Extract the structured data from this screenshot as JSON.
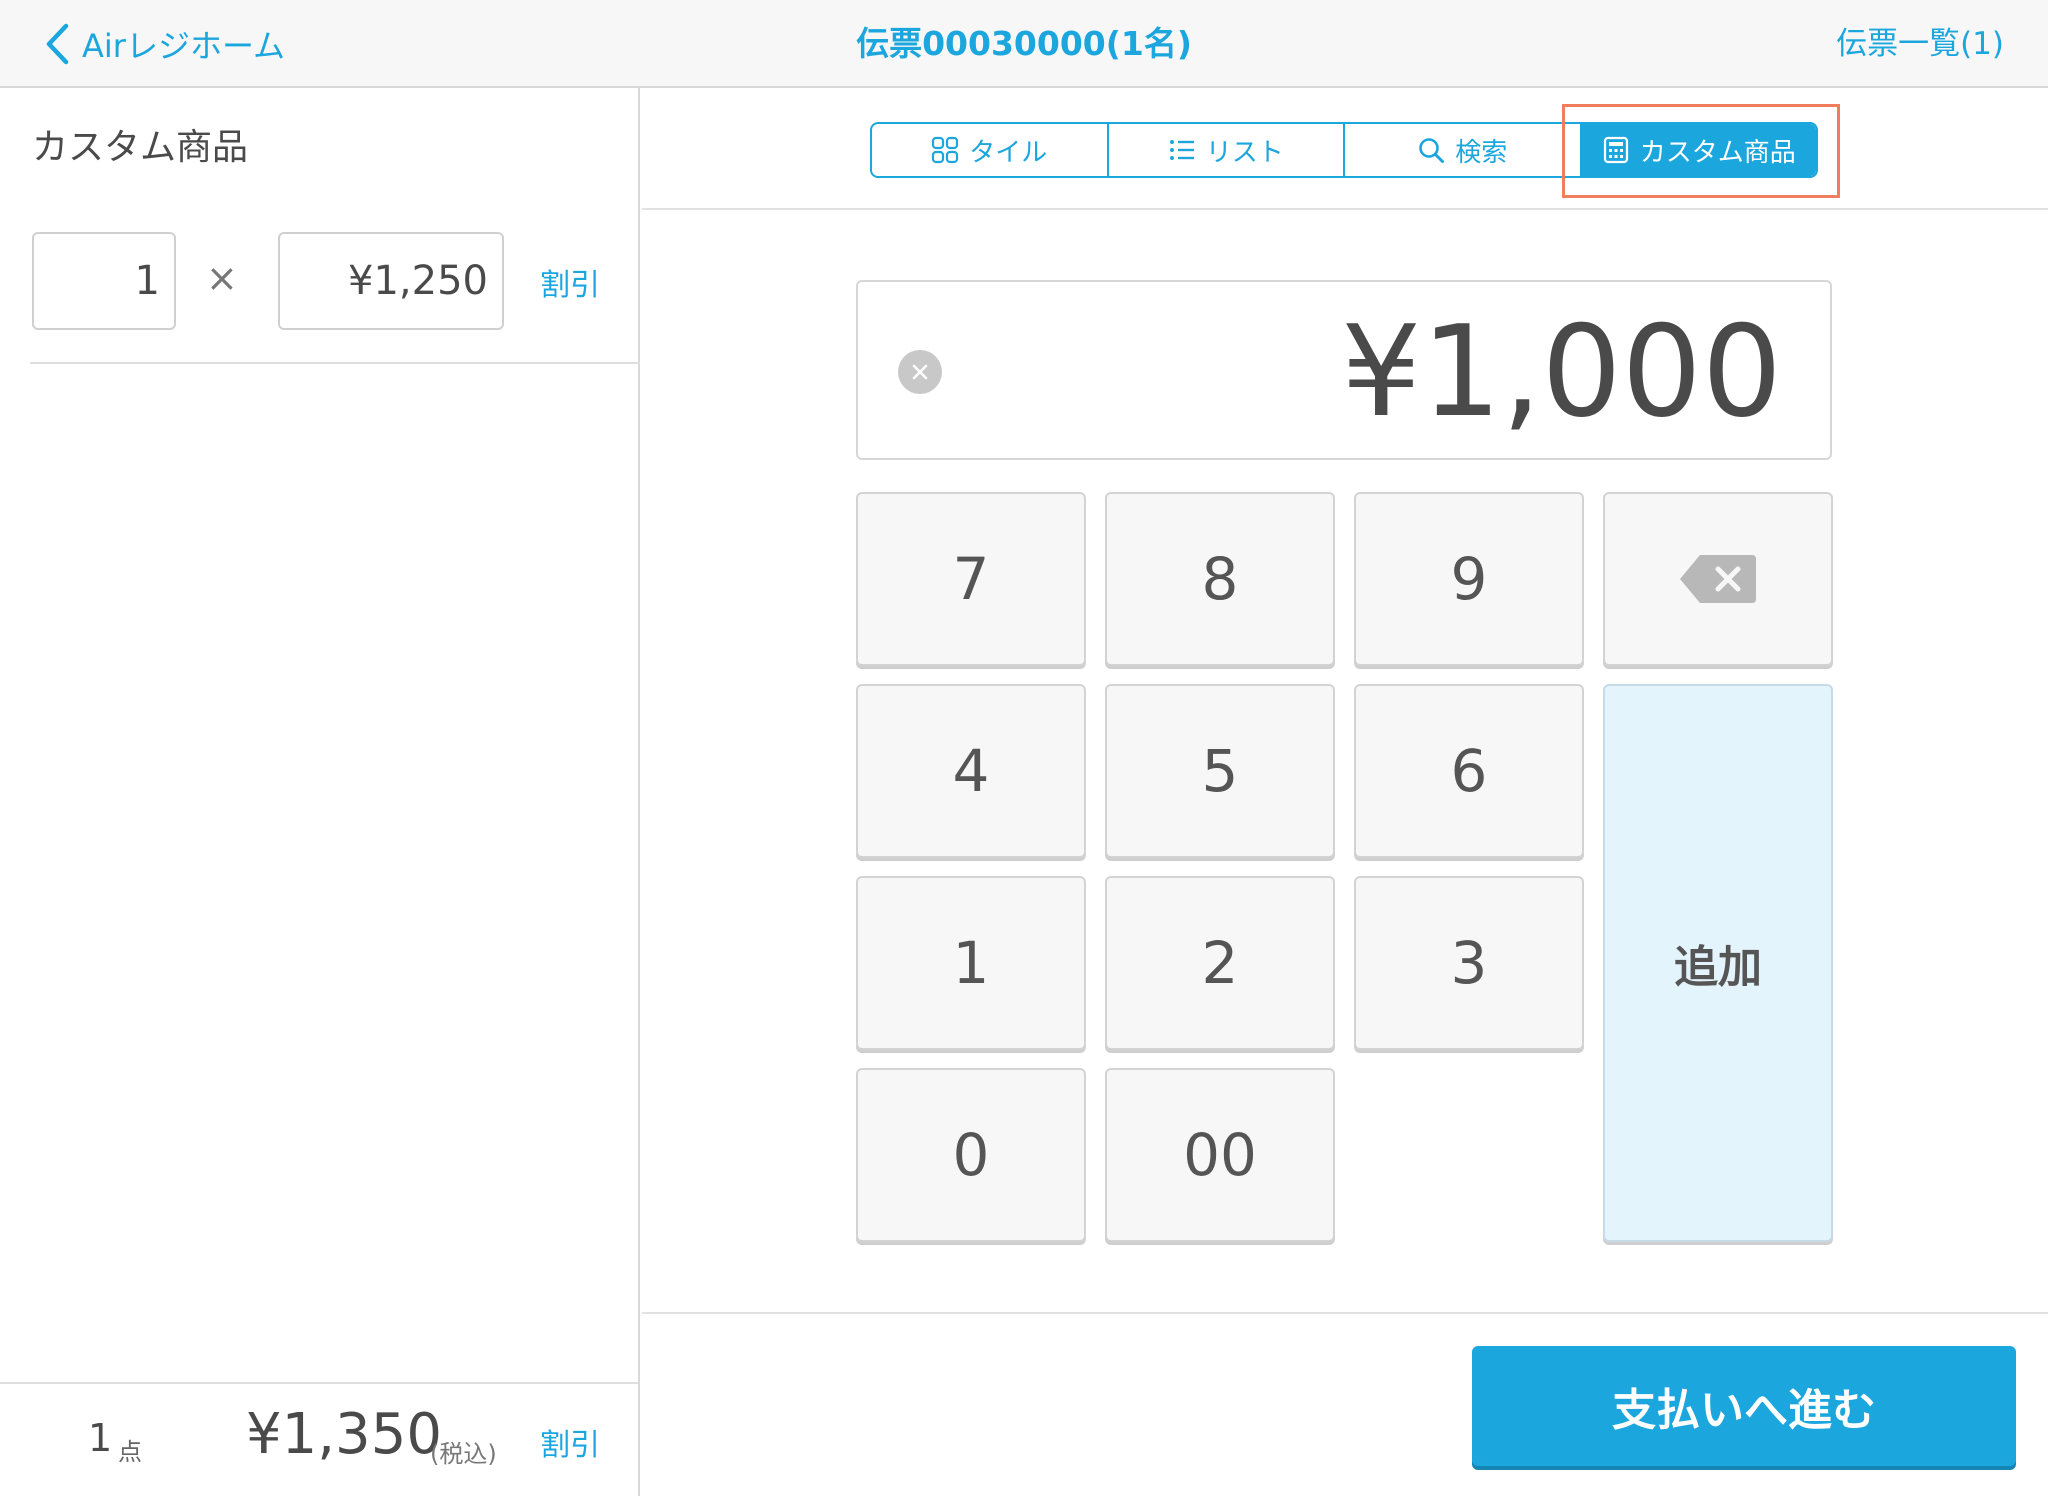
{
  "header": {
    "back_label": "Airレジホーム",
    "title": "伝票00030000(1名)",
    "slip_list_label": "伝票一覧(1)"
  },
  "left_panel": {
    "item_name": "カスタム商品",
    "quantity": "1",
    "times_symbol": "×",
    "unit_price": "¥1,250",
    "discount_label": "割引",
    "footer": {
      "count": "1",
      "count_unit": "点",
      "total": "¥1,350",
      "tax_note": "(税込)",
      "discount_label": "割引"
    }
  },
  "segments": [
    {
      "label": "タイル",
      "icon": "tile-grid-icon"
    },
    {
      "label": "リスト",
      "icon": "list-icon"
    },
    {
      "label": "検索",
      "icon": "search-icon"
    },
    {
      "label": "カスタム商品",
      "icon": "calculator-icon",
      "active": true
    }
  ],
  "display": {
    "amount": "¥1,000"
  },
  "keypad": {
    "k7": "7",
    "k8": "8",
    "k9": "9",
    "k4": "4",
    "k5": "5",
    "k6": "6",
    "k1": "1",
    "k2": "2",
    "k3": "3",
    "k0": "0",
    "k00": "00",
    "add": "追加"
  },
  "pay_button": "支払いへ進む",
  "colors": {
    "accent": "#1ca6de",
    "highlight_outline": "#ef7d5e",
    "add_key_bg": "#e4f4fd"
  }
}
